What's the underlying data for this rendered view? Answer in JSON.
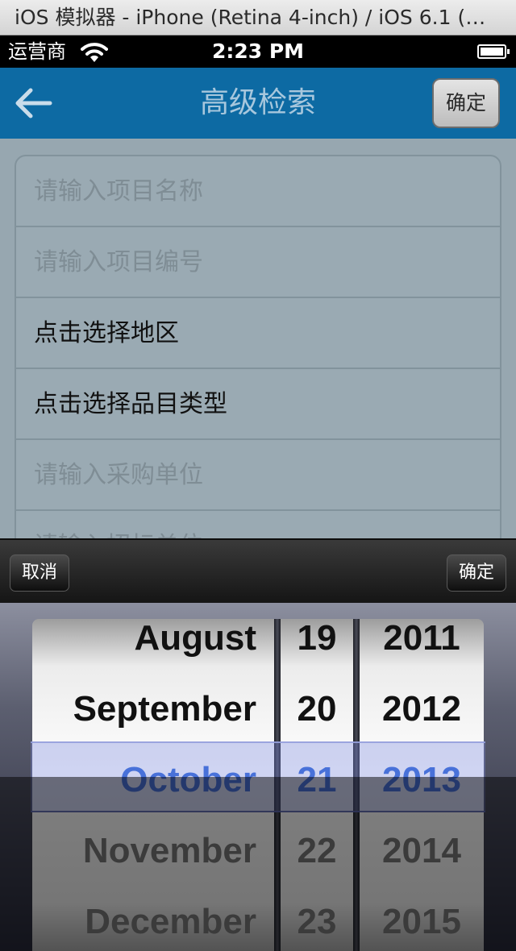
{
  "simulator": {
    "title": "iOS 模拟器 - iPhone (Retina 4-inch) / iOS 6.1 (…"
  },
  "status_bar": {
    "carrier": "运营商",
    "time": "2:23 PM"
  },
  "nav": {
    "title": "高级检索",
    "confirm_label": "确定"
  },
  "form": {
    "rows": [
      {
        "text": "请输入项目名称",
        "kind": "placeholder"
      },
      {
        "text": "请输入项目编号",
        "kind": "placeholder"
      },
      {
        "text": "点击选择地区",
        "kind": "selector"
      },
      {
        "text": "点击选择品目类型",
        "kind": "selector"
      },
      {
        "text": "请输入采购单位",
        "kind": "placeholder"
      },
      {
        "text": "请输入招标单位",
        "kind": "placeholder"
      }
    ]
  },
  "picker_toolbar": {
    "cancel_label": "取消",
    "done_label": "确定"
  },
  "date_picker": {
    "months": [
      "August",
      "September",
      "October",
      "November",
      "December"
    ],
    "days": [
      "19",
      "20",
      "21",
      "22",
      "23"
    ],
    "years": [
      "2011",
      "2012",
      "2013",
      "2014",
      "2015"
    ],
    "selected": {
      "month": "October",
      "day": "21",
      "year": "2013"
    }
  },
  "colors": {
    "nav_bar": "#0d6aa3",
    "nav_title": "#a7c7dd",
    "selected_value": "#2f66d8",
    "form_background": "#97a7b0"
  },
  "icons": {
    "back": "left-arrow-icon",
    "wifi": "wifi-icon",
    "battery": "battery-icon"
  }
}
